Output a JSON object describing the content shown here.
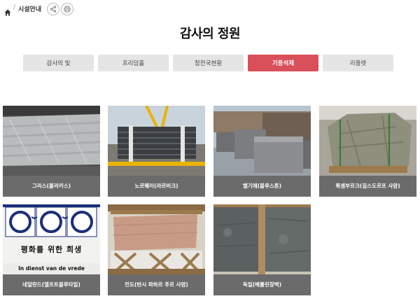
{
  "breadcrumb": {
    "current": "시설안내",
    "separator": "/"
  },
  "title": "감사의 정원",
  "tabs": [
    {
      "label": "감사의 빛",
      "active": false
    },
    {
      "label": "프리덤홀",
      "active": false
    },
    {
      "label": "참전국현황",
      "active": false
    },
    {
      "label": "기증석재",
      "active": true
    },
    {
      "label": "리플렛",
      "active": false
    }
  ],
  "gallery": [
    {
      "caption": "그리스(볼라카스)"
    },
    {
      "caption": "노르웨이(라르비크)"
    },
    {
      "caption": "벨기에(블루스톤)"
    },
    {
      "caption": "룩셈부르크(길스도르프 사암)"
    },
    {
      "caption": "네덜란드(델프트블루타일)"
    },
    {
      "caption": "인도(반시 파하르 푸르 사암)"
    },
    {
      "caption": "독일(베를린장벽)"
    }
  ],
  "tile_text": {
    "line1": "평화를 위한 희생",
    "line2": "In dienst van de vrede"
  },
  "colors": {
    "accent": "#d9505b",
    "tab_bg": "#e5e5e5",
    "caption_bg": "#6b6b6b"
  },
  "icons": {
    "home": "home-icon",
    "share": "share-icon",
    "print": "print-icon"
  }
}
